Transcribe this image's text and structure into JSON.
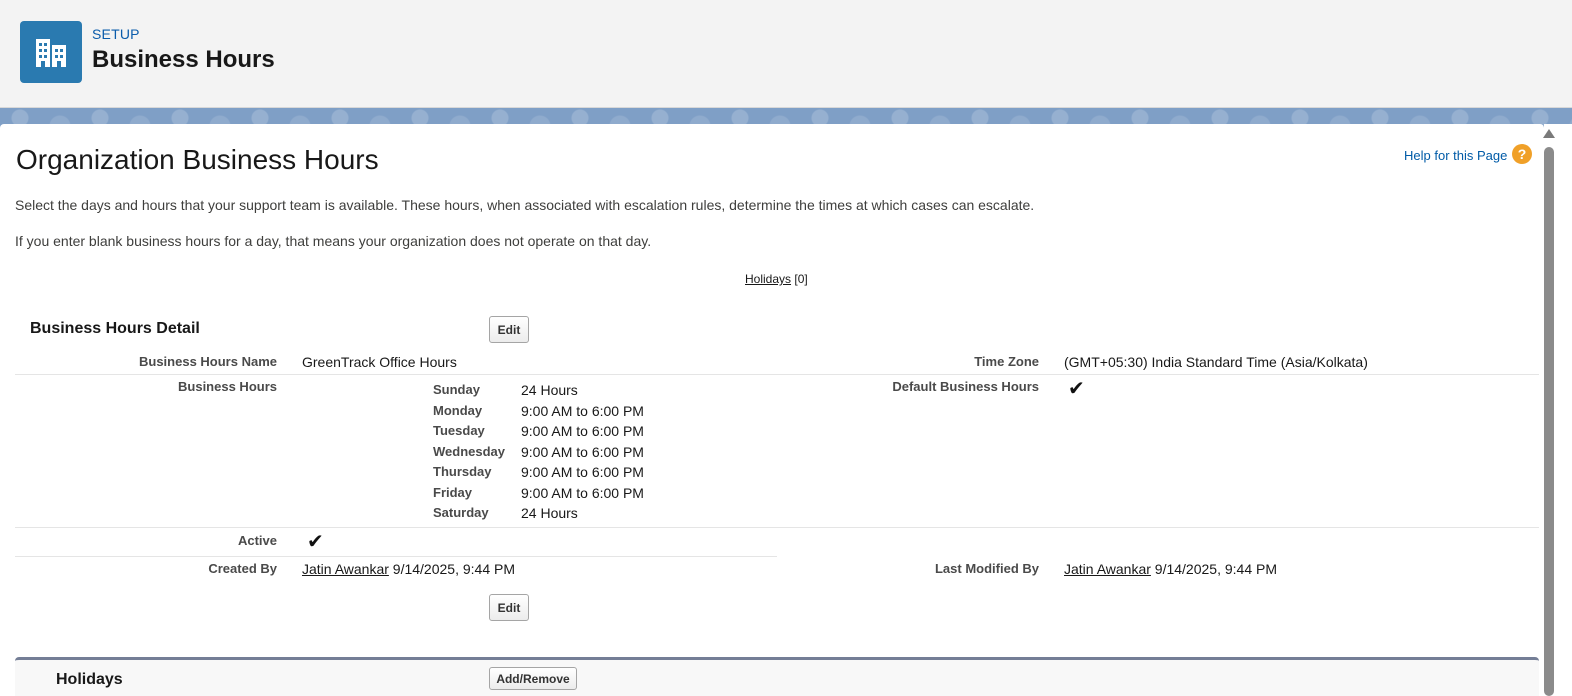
{
  "header": {
    "setup_label": "SETUP",
    "title": "Business Hours",
    "icon": "building-icon",
    "icon_color": "#2a7ab0"
  },
  "page": {
    "title": "Organization Business Hours",
    "help_link": "Help for this Page",
    "help_icon": "?",
    "description_1": "Select the days and hours that your support team is available. These hours, when associated with escalation rules, determine the times at which cases can escalate.",
    "description_2": "If you enter blank business hours for a day, that means your organization does not operate on that day.",
    "holidays_link": "Holidays",
    "holidays_count": "[0]"
  },
  "detail": {
    "section_title": "Business Hours Detail",
    "edit_label": "Edit",
    "name_label": "Business Hours Name",
    "name_value": "GreenTrack Office Hours",
    "timezone_label": "Time Zone",
    "timezone_value": "(GMT+05:30) India Standard Time (Asia/Kolkata)",
    "hours_label": "Business Hours",
    "default_label": "Default Business Hours",
    "default_checked": "✔",
    "days": [
      {
        "day": "Sunday",
        "hours": "24 Hours"
      },
      {
        "day": "Monday",
        "hours": "9:00 AM to 6:00 PM"
      },
      {
        "day": "Tuesday",
        "hours": "9:00 AM to 6:00 PM"
      },
      {
        "day": "Wednesday",
        "hours": "9:00 AM to 6:00 PM"
      },
      {
        "day": "Thursday",
        "hours": "9:00 AM to 6:00 PM"
      },
      {
        "day": "Friday",
        "hours": "9:00 AM to 6:00 PM"
      },
      {
        "day": "Saturday",
        "hours": "24 Hours"
      }
    ],
    "active_label": "Active",
    "active_checked": "✔",
    "created_label": "Created By",
    "created_user": "Jatin Awankar",
    "created_date": "9/14/2025, 9:44 PM",
    "modified_label": "Last Modified By",
    "modified_user": "Jatin Awankar",
    "modified_date": "9/14/2025, 9:44 PM"
  },
  "holidays": {
    "section_title": "Holidays",
    "add_remove_label": "Add/Remove"
  }
}
